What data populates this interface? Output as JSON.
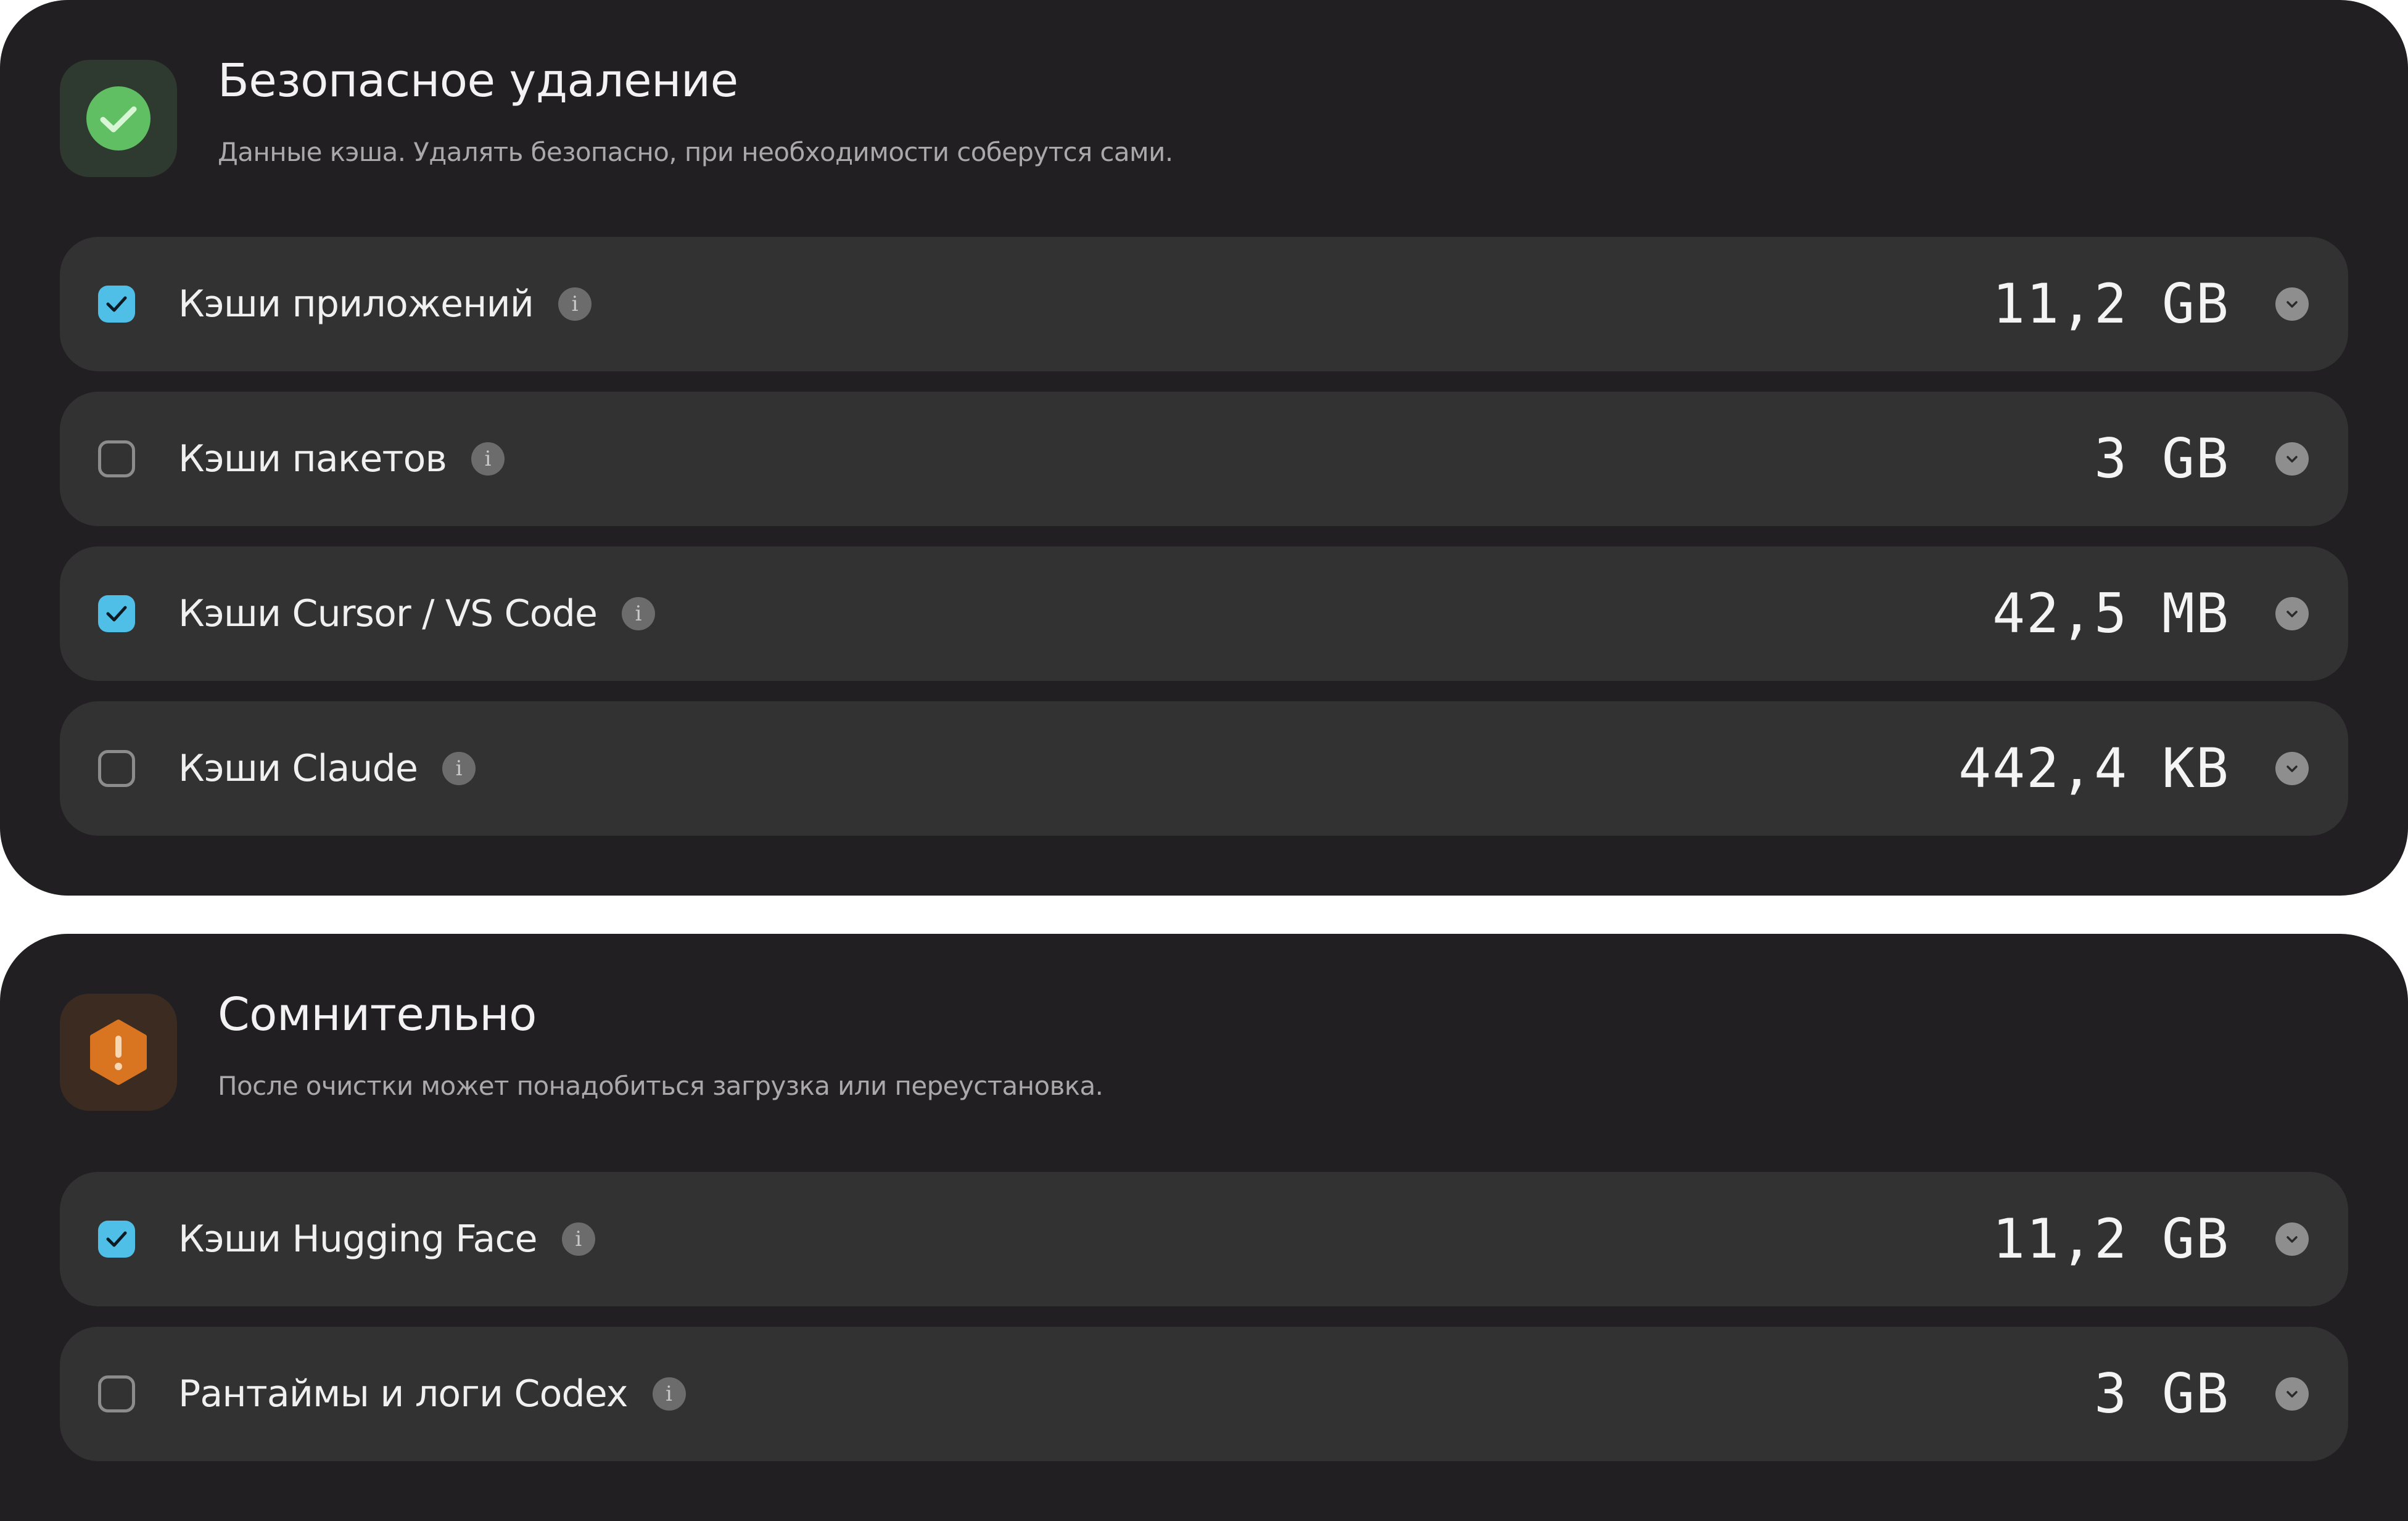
{
  "sections": [
    {
      "title": "Безопасное удаление",
      "subtitle": "Данные кэша. Удалять безопасно, при необходимости соберутся сами.",
      "icon": "check-circle-icon",
      "accent": "#5fbf62",
      "items": [
        {
          "label": "Кэши приложений",
          "size": "11,2 GB",
          "checked": true
        },
        {
          "label": "Кэши пакетов",
          "size": "3 GB",
          "checked": false
        },
        {
          "label": "Кэши Cursor / VS Code",
          "size": "42,5 MB",
          "checked": true
        },
        {
          "label": "Кэши Claude",
          "size": "442,4 KB",
          "checked": false
        }
      ]
    },
    {
      "title": "Сомнительно",
      "subtitle": "После очистки может понадобиться загрузка или переустановка.",
      "icon": "warning-hexagon-icon",
      "accent": "#d97420",
      "items": [
        {
          "label": "Кэши Hugging Face",
          "size": "11,2 GB",
          "checked": true
        },
        {
          "label": "Рантаймы и логи Codex",
          "size": "3 GB",
          "checked": false
        }
      ]
    }
  ],
  "info_glyph": "i",
  "colors": {
    "panel": "#211f21",
    "row": "#333233",
    "checkbox_checked": "#4fbfe8"
  }
}
